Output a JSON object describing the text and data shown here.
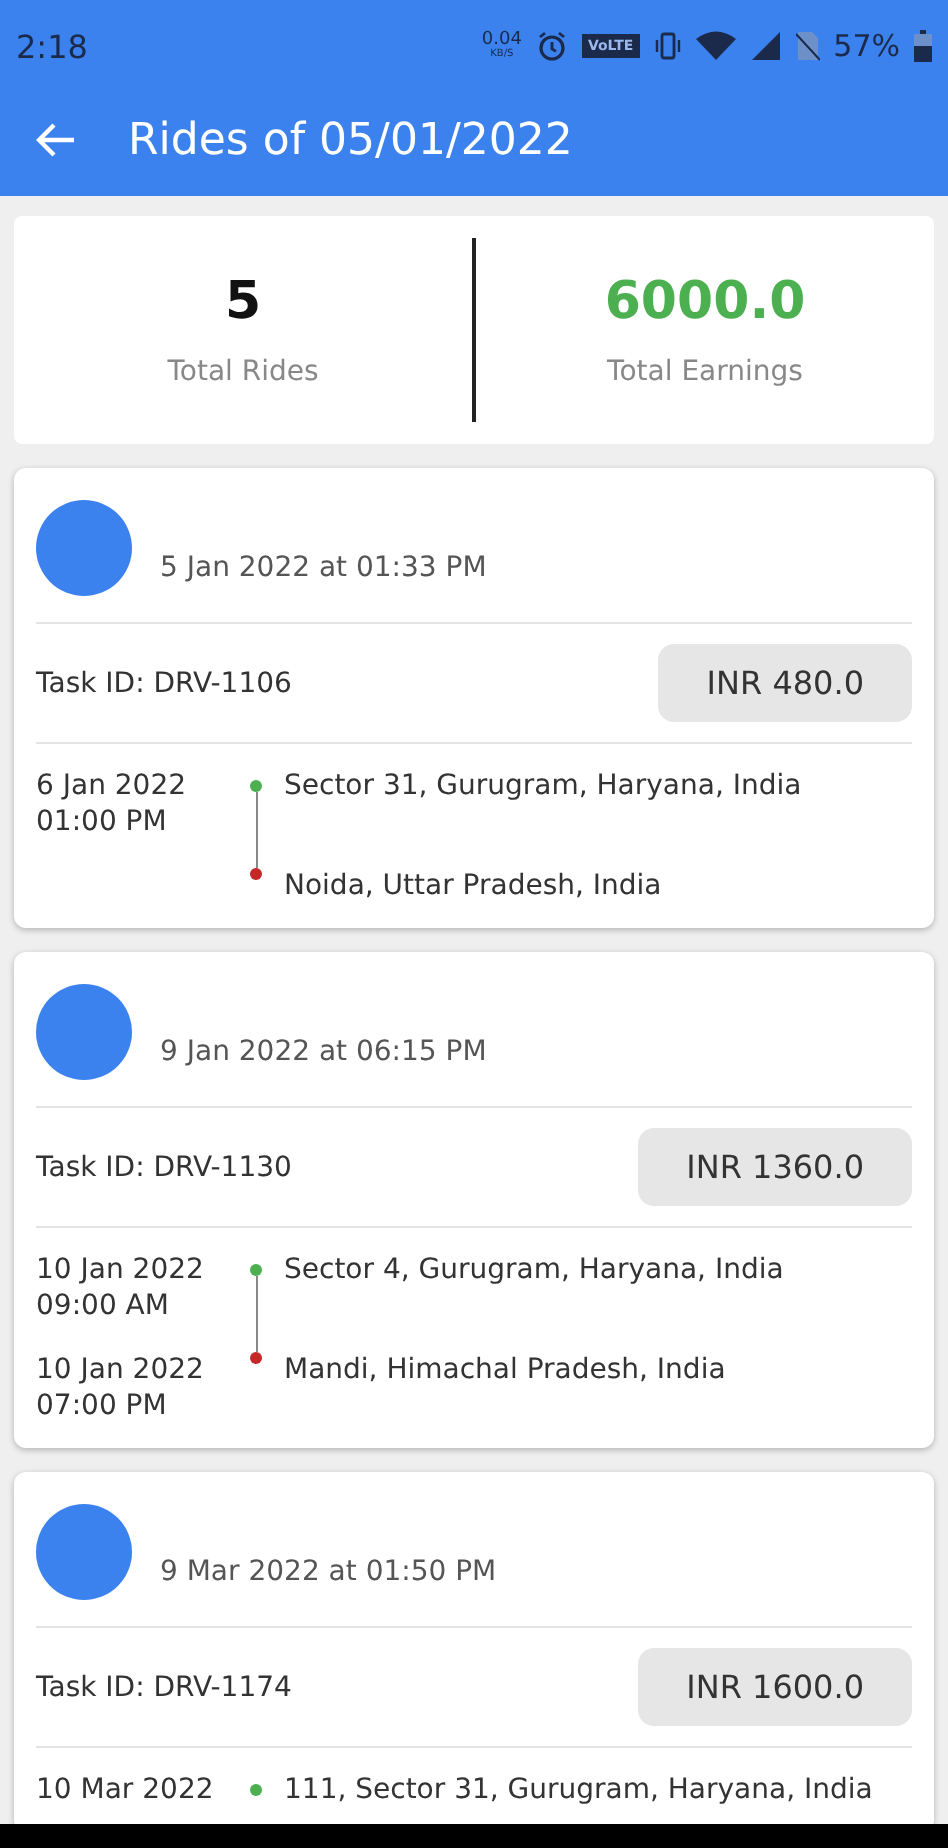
{
  "status_bar": {
    "time": "2:18",
    "speed": "0.04",
    "speed_unit": "KB/S",
    "network": "VoLTE",
    "battery": "57%"
  },
  "app_bar": {
    "title": "Rides of 05/01/2022"
  },
  "summary": [
    {
      "value": "5",
      "label": "Total Rides",
      "kind": "count"
    },
    {
      "value": "6000.0",
      "label": "Total Earnings",
      "kind": "money"
    }
  ],
  "rides": [
    {
      "created": "5 Jan 2022 at 01:33 PM",
      "task_id": "Task ID: DRV-1106",
      "fare": "INR 480.0",
      "stops": [
        {
          "kind": "pickup",
          "date": "6 Jan 2022",
          "time": "01:00 PM",
          "address": "Sector 31, Gurugram, Haryana, India"
        },
        {
          "kind": "drop",
          "address": "Noida, Uttar Pradesh, India"
        }
      ]
    },
    {
      "created": "9 Jan 2022 at 06:15 PM",
      "task_id": "Task ID: DRV-1130",
      "fare": "INR 1360.0",
      "stops": [
        {
          "kind": "pickup",
          "date": "10 Jan 2022",
          "time": "09:00 AM",
          "address": "Sector 4, Gurugram, Haryana, India"
        },
        {
          "kind": "drop",
          "date": "10 Jan 2022",
          "time": "07:00 PM",
          "address": "Mandi, Himachal Pradesh, India"
        }
      ]
    },
    {
      "created": "9 Mar 2022 at 01:50 PM",
      "task_id": "Task ID: DRV-1174",
      "fare": "INR 1600.0",
      "stops": [
        {
          "kind": "pickup",
          "date": "10 Mar 2022",
          "address": "111, Sector 31, Gurugram, Haryana, India"
        }
      ]
    }
  ]
}
